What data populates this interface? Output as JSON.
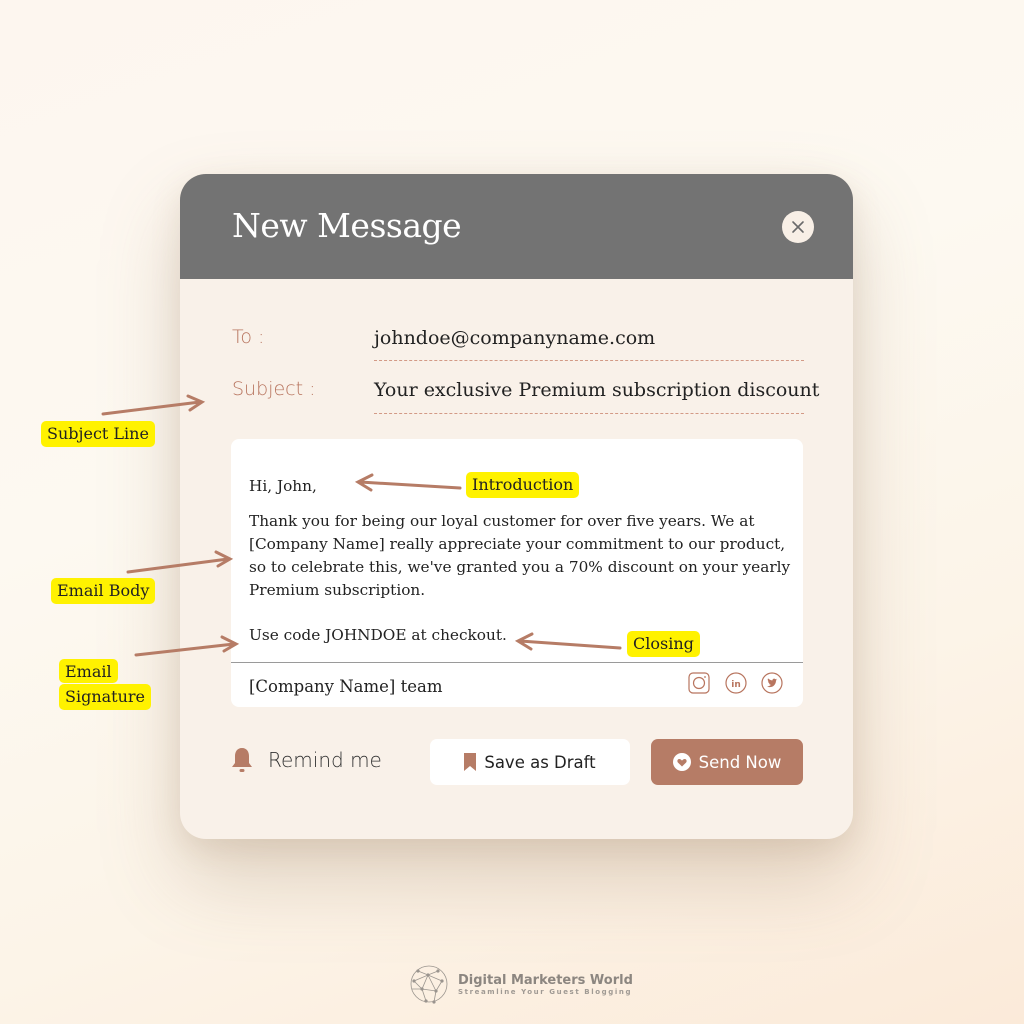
{
  "window": {
    "title": "New Message",
    "close_icon": "close-icon"
  },
  "fields": {
    "to_label": "To :",
    "to_value": "johndoe@companyname.com",
    "subject_label": "Subject :",
    "subject_value": "Your exclusive Premium subscription discount"
  },
  "email": {
    "greeting": "Hi, John,",
    "body_lines": [
      "Thank you for being our loyal customer for over five years. We at",
      "[Company Name] really appreciate your commitment to our product,",
      "so to celebrate this, we've granted you a 70% discount on your yearly",
      "Premium subscription."
    ],
    "closing": "Use code JOHNDOE at checkout.",
    "signature": "[Company Name] team",
    "social_icons": [
      "instagram-icon",
      "linkedin-icon",
      "twitter-icon"
    ]
  },
  "actions": {
    "remind_label": "Remind me",
    "draft_label": "Save as Draft",
    "send_label": "Send Now"
  },
  "annotations": {
    "subject_line": "Subject Line",
    "introduction": "Introduction",
    "email_body": "Email Body",
    "closing": "Closing",
    "email_signature_1": "Email",
    "email_signature_2": "Signature"
  },
  "branding": {
    "name": "Digital Marketers World",
    "tagline": "Streamline Your Guest Blogging"
  },
  "colors": {
    "accent": "#b67c66",
    "header": "#737373",
    "highlight": "#fff200"
  }
}
